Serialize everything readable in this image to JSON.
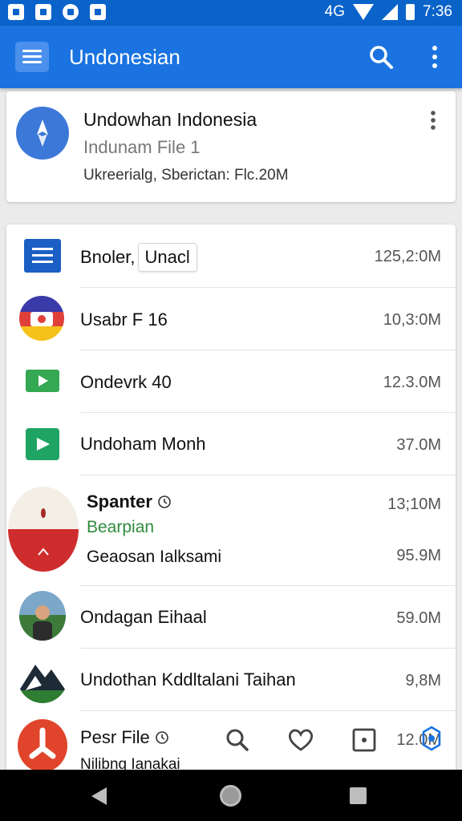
{
  "status_bar": {
    "time": "7:36",
    "network_label": "4G"
  },
  "app_bar": {
    "title": "Undonesian"
  },
  "header_card": {
    "title": "Undowhan Indonesia",
    "subtitle": "Indunam File 1",
    "meta": "Ukreerialg, Sberictan: Flc.20M"
  },
  "files": [
    {
      "name": "Bnoler,",
      "chip": "Unacl",
      "size": "125,2:0M",
      "icon": "document-icon"
    },
    {
      "name": "Usabr F 16",
      "size": "10,3:0M",
      "icon": "camera-icon"
    },
    {
      "name": "Ondevrk 40",
      "size": "12.3.0M",
      "icon": "video-icon"
    },
    {
      "name": "Undoham Monh",
      "size": "37.0M",
      "icon": "slides-icon"
    },
    {
      "name": "Spanter",
      "size": "13;10M",
      "secondary": "Bearpian",
      "tertiary": "Geaosan Ialksami",
      "size2": "95.9M",
      "icon": "flag-icon"
    },
    {
      "name": "Ondagan Eihaal",
      "size": "59.0M",
      "icon": "person-photo"
    },
    {
      "name": "Undothan Kddltalani Taihan",
      "size": "9,8M",
      "icon": "mountain-icon"
    },
    {
      "name": "Pesr File",
      "size": "12.0M",
      "tertiary": "Nilibng Ianakai",
      "icon": "red-logo-icon"
    }
  ],
  "colors": {
    "status_bar": "#0a63c9",
    "app_bar": "#1a73e0",
    "secondary_green": "#2e8b3c"
  }
}
